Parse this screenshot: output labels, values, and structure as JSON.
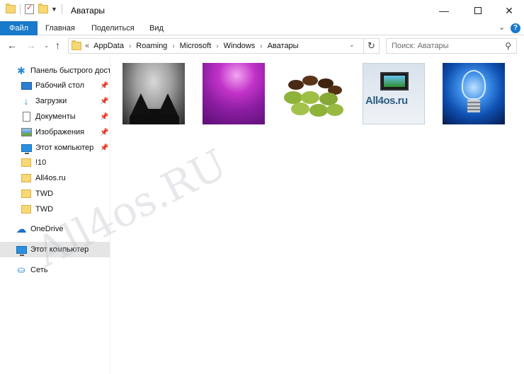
{
  "window": {
    "title": "Аватары",
    "controls": {
      "minimize": "—",
      "close": "✕"
    }
  },
  "ribbon": {
    "tabs": [
      {
        "label": "Файл",
        "active": true
      },
      {
        "label": "Главная"
      },
      {
        "label": "Поделиться"
      },
      {
        "label": "Вид"
      }
    ],
    "help": "?"
  },
  "nav": {
    "back": "←",
    "forward": "→",
    "up": "↑",
    "breadcrumb_prefix": "«",
    "breadcrumb": [
      "AppData",
      "Roaming",
      "Microsoft",
      "Windows",
      "Аватары"
    ],
    "search_placeholder": "Поиск: Аватары"
  },
  "sidebar": {
    "quick_access": {
      "label": "Панель быстрого доступа",
      "icon": "star-icon"
    },
    "pinned": [
      {
        "label": "Рабочий стол",
        "icon": "desktop-icon",
        "pinned": true
      },
      {
        "label": "Загрузки",
        "icon": "download-icon",
        "pinned": true
      },
      {
        "label": "Документы",
        "icon": "documents-icon",
        "pinned": true
      },
      {
        "label": "Изображения",
        "icon": "pictures-icon",
        "pinned": true
      },
      {
        "label": "Этот компьютер",
        "icon": "computer-icon",
        "pinned": true
      }
    ],
    "folders": [
      {
        "label": "!10",
        "icon": "folder-icon"
      },
      {
        "label": "All4os.ru",
        "icon": "folder-icon"
      },
      {
        "label": "TWD",
        "icon": "folder-icon"
      },
      {
        "label": "TWD",
        "icon": "folder-icon"
      }
    ],
    "onedrive": {
      "label": "OneDrive",
      "icon": "onedrive-icon"
    },
    "this_pc": {
      "label": "Этот компьютер",
      "icon": "computer-icon",
      "selected": true
    },
    "network": {
      "label": "Сеть",
      "icon": "network-icon"
    }
  },
  "content": {
    "thumbnails": [
      {
        "name": "cat-ears-thumbnail"
      },
      {
        "name": "purple-gradient-thumbnail"
      },
      {
        "name": "coffee-beans-thumbnail"
      },
      {
        "name": "all4os-logo-thumbnail",
        "brand_text": "All4os.ru"
      },
      {
        "name": "lightbulb-thumbnail"
      }
    ]
  },
  "watermark": "All4os.RU"
}
